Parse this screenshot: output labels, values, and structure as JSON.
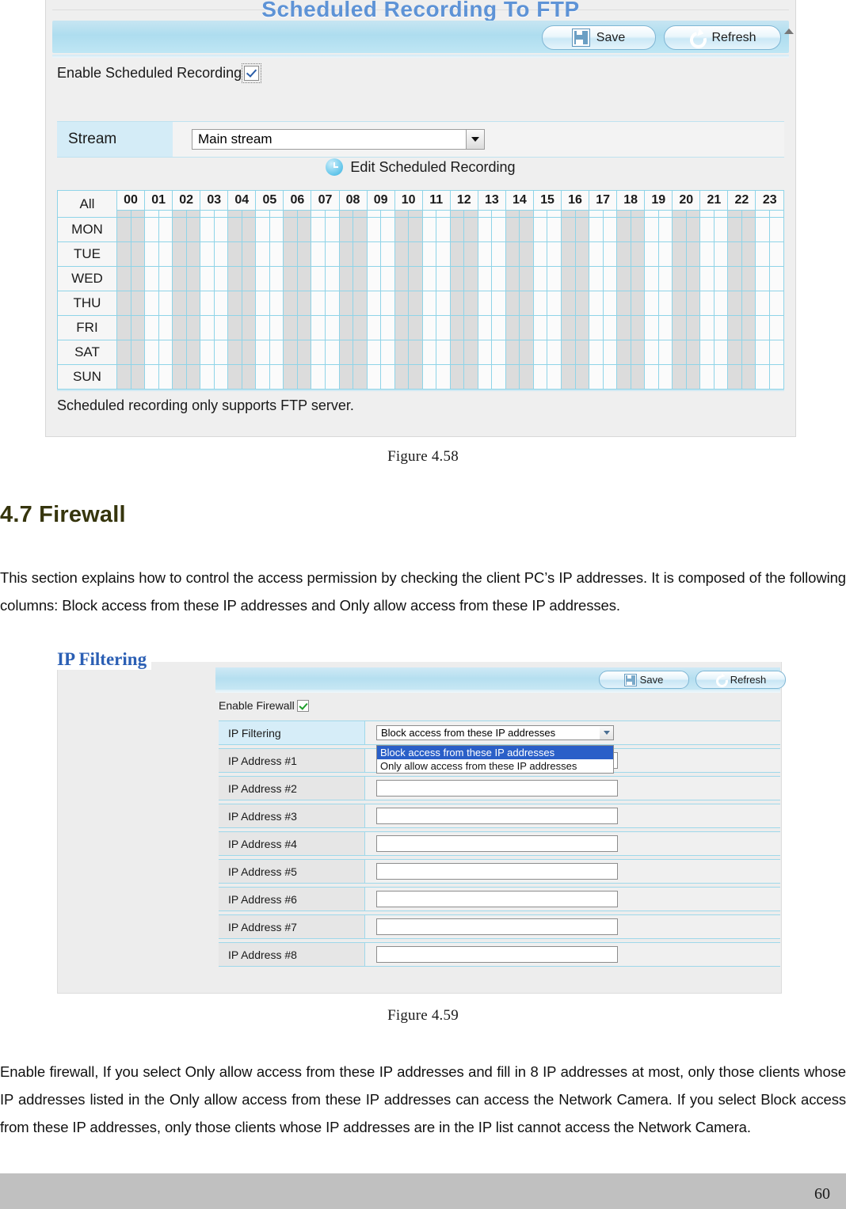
{
  "figure_458": {
    "title": "Scheduled Recording To FTP",
    "toolbar": {
      "save_label": "Save",
      "refresh_label": "Refresh"
    },
    "enable_label": "Enable Scheduled Recording",
    "enable_checked": true,
    "stream": {
      "label": "Stream",
      "value": "Main stream"
    },
    "edit_schedule_label": "Edit Scheduled Recording",
    "grid": {
      "all_label": "All",
      "hours": [
        "00",
        "01",
        "02",
        "03",
        "04",
        "05",
        "06",
        "07",
        "08",
        "09",
        "10",
        "11",
        "12",
        "13",
        "14",
        "15",
        "16",
        "17",
        "18",
        "19",
        "20",
        "21",
        "22",
        "23"
      ],
      "days": [
        "MON",
        "TUE",
        "WED",
        "THU",
        "FRI",
        "SAT",
        "SUN"
      ]
    },
    "note": "Scheduled recording only supports FTP server.",
    "caption": "Figure 4.58"
  },
  "section": {
    "heading": "4.7 Firewall",
    "intro": "This section explains how to control the access permission by checking the client PC’s IP addresses. It is composed of the following columns: Block access from these IP addresses and Only allow access from these IP addresses.",
    "outro": "Enable firewall, If you select Only allow access from these IP addresses and fill in 8 IP addresses at most, only those clients whose IP addresses listed in the Only allow access from these IP addresses can access the Network Camera. If you select Block access from these IP addresses, only those clients whose IP addresses are in the IP list cannot access the Network Camera."
  },
  "figure_459": {
    "legend": "IP Filtering",
    "toolbar": {
      "save_label": "Save",
      "refresh_label": "Refresh"
    },
    "enable_label": "Enable Firewall",
    "enable_checked": true,
    "ip_filtering": {
      "label": "IP Filtering",
      "selected": "Block access from these IP addresses",
      "options": [
        "Block access from these IP addresses",
        "Only allow access from these IP addresses"
      ],
      "dropdown_open": true
    },
    "ip_rows": [
      {
        "label": "IP Address #1",
        "value": ""
      },
      {
        "label": "IP Address #2",
        "value": ""
      },
      {
        "label": "IP Address #3",
        "value": ""
      },
      {
        "label": "IP Address #4",
        "value": ""
      },
      {
        "label": "IP Address #5",
        "value": ""
      },
      {
        "label": "IP Address #6",
        "value": ""
      },
      {
        "label": "IP Address #7",
        "value": ""
      },
      {
        "label": "IP Address #8",
        "value": ""
      }
    ],
    "caption": "Figure 4.59"
  },
  "footer": {
    "page_number": "60"
  },
  "colors": {
    "heading": "#36350D",
    "panel_title": "#5E93D6",
    "legend": "#2B5FB4",
    "toolbar": "#AEDDEF",
    "grid_line": "#8FD4E8",
    "dropdown_selection": "#2A5FC8",
    "footer_band": "#C0C0C0"
  }
}
